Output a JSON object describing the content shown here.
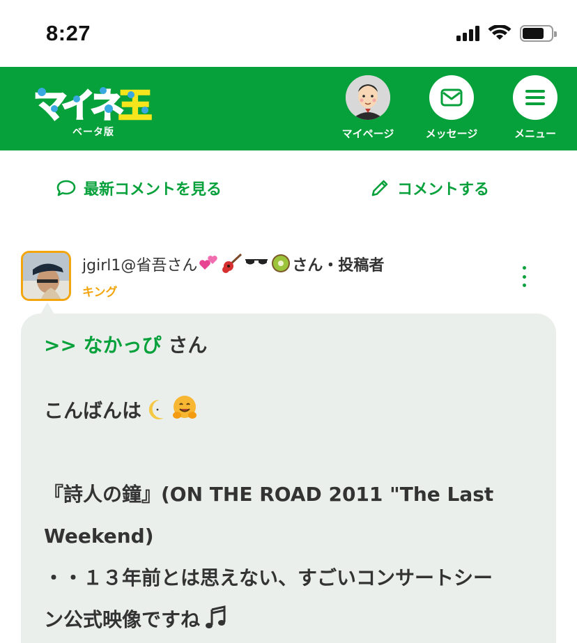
{
  "status_bar": {
    "time": "8:27"
  },
  "header": {
    "logo_alt": "マイネ王",
    "logo_sub": "ベータ版",
    "buttons": [
      {
        "label": "マイページ",
        "icon": "avatar-icon"
      },
      {
        "label": "メッセージ",
        "icon": "mail-icon"
      },
      {
        "label": "メニュー",
        "icon": "menu-icon"
      }
    ]
  },
  "actions": {
    "latest_comments": "最新コメントを見る",
    "comment": "コメントする"
  },
  "comment": {
    "author": "jgirl1@省吾さん",
    "author_suffix": "さん・投稿者",
    "rank": "キング",
    "reply_to": ">> なかっぴ",
    "reply_suffix": " さん",
    "lines": [
      "こんばんは",
      "『詩人の鐘』(ON THE ROAD 2011 \"The Last",
      "Weekend)",
      "・・１３年前とは思えない、すごいコンサートシー",
      "ン公式映像ですね"
    ]
  },
  "colors": {
    "brand_green": "#07a13b",
    "rank_orange": "#f2a50c",
    "bubble_bg": "#ebefec"
  }
}
